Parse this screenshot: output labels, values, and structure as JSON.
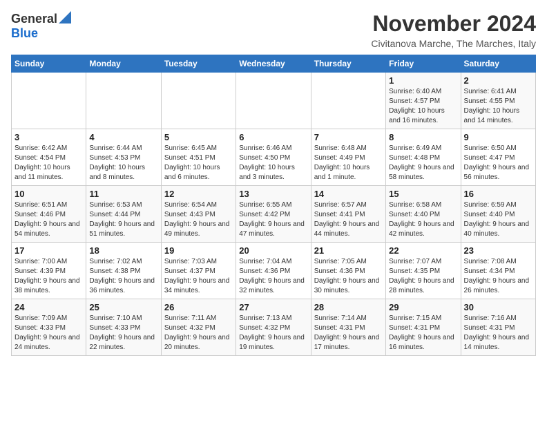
{
  "logo": {
    "general": "General",
    "blue": "Blue"
  },
  "title": "November 2024",
  "location": "Civitanova Marche, The Marches, Italy",
  "days_header": [
    "Sunday",
    "Monday",
    "Tuesday",
    "Wednesday",
    "Thursday",
    "Friday",
    "Saturday"
  ],
  "weeks": [
    [
      {
        "day": "",
        "info": ""
      },
      {
        "day": "",
        "info": ""
      },
      {
        "day": "",
        "info": ""
      },
      {
        "day": "",
        "info": ""
      },
      {
        "day": "",
        "info": ""
      },
      {
        "day": "1",
        "info": "Sunrise: 6:40 AM\nSunset: 4:57 PM\nDaylight: 10 hours and 16 minutes."
      },
      {
        "day": "2",
        "info": "Sunrise: 6:41 AM\nSunset: 4:55 PM\nDaylight: 10 hours and 14 minutes."
      }
    ],
    [
      {
        "day": "3",
        "info": "Sunrise: 6:42 AM\nSunset: 4:54 PM\nDaylight: 10 hours and 11 minutes."
      },
      {
        "day": "4",
        "info": "Sunrise: 6:44 AM\nSunset: 4:53 PM\nDaylight: 10 hours and 8 minutes."
      },
      {
        "day": "5",
        "info": "Sunrise: 6:45 AM\nSunset: 4:51 PM\nDaylight: 10 hours and 6 minutes."
      },
      {
        "day": "6",
        "info": "Sunrise: 6:46 AM\nSunset: 4:50 PM\nDaylight: 10 hours and 3 minutes."
      },
      {
        "day": "7",
        "info": "Sunrise: 6:48 AM\nSunset: 4:49 PM\nDaylight: 10 hours and 1 minute."
      },
      {
        "day": "8",
        "info": "Sunrise: 6:49 AM\nSunset: 4:48 PM\nDaylight: 9 hours and 58 minutes."
      },
      {
        "day": "9",
        "info": "Sunrise: 6:50 AM\nSunset: 4:47 PM\nDaylight: 9 hours and 56 minutes."
      }
    ],
    [
      {
        "day": "10",
        "info": "Sunrise: 6:51 AM\nSunset: 4:46 PM\nDaylight: 9 hours and 54 minutes."
      },
      {
        "day": "11",
        "info": "Sunrise: 6:53 AM\nSunset: 4:44 PM\nDaylight: 9 hours and 51 minutes."
      },
      {
        "day": "12",
        "info": "Sunrise: 6:54 AM\nSunset: 4:43 PM\nDaylight: 9 hours and 49 minutes."
      },
      {
        "day": "13",
        "info": "Sunrise: 6:55 AM\nSunset: 4:42 PM\nDaylight: 9 hours and 47 minutes."
      },
      {
        "day": "14",
        "info": "Sunrise: 6:57 AM\nSunset: 4:41 PM\nDaylight: 9 hours and 44 minutes."
      },
      {
        "day": "15",
        "info": "Sunrise: 6:58 AM\nSunset: 4:40 PM\nDaylight: 9 hours and 42 minutes."
      },
      {
        "day": "16",
        "info": "Sunrise: 6:59 AM\nSunset: 4:40 PM\nDaylight: 9 hours and 40 minutes."
      }
    ],
    [
      {
        "day": "17",
        "info": "Sunrise: 7:00 AM\nSunset: 4:39 PM\nDaylight: 9 hours and 38 minutes."
      },
      {
        "day": "18",
        "info": "Sunrise: 7:02 AM\nSunset: 4:38 PM\nDaylight: 9 hours and 36 minutes."
      },
      {
        "day": "19",
        "info": "Sunrise: 7:03 AM\nSunset: 4:37 PM\nDaylight: 9 hours and 34 minutes."
      },
      {
        "day": "20",
        "info": "Sunrise: 7:04 AM\nSunset: 4:36 PM\nDaylight: 9 hours and 32 minutes."
      },
      {
        "day": "21",
        "info": "Sunrise: 7:05 AM\nSunset: 4:36 PM\nDaylight: 9 hours and 30 minutes."
      },
      {
        "day": "22",
        "info": "Sunrise: 7:07 AM\nSunset: 4:35 PM\nDaylight: 9 hours and 28 minutes."
      },
      {
        "day": "23",
        "info": "Sunrise: 7:08 AM\nSunset: 4:34 PM\nDaylight: 9 hours and 26 minutes."
      }
    ],
    [
      {
        "day": "24",
        "info": "Sunrise: 7:09 AM\nSunset: 4:33 PM\nDaylight: 9 hours and 24 minutes."
      },
      {
        "day": "25",
        "info": "Sunrise: 7:10 AM\nSunset: 4:33 PM\nDaylight: 9 hours and 22 minutes."
      },
      {
        "day": "26",
        "info": "Sunrise: 7:11 AM\nSunset: 4:32 PM\nDaylight: 9 hours and 20 minutes."
      },
      {
        "day": "27",
        "info": "Sunrise: 7:13 AM\nSunset: 4:32 PM\nDaylight: 9 hours and 19 minutes."
      },
      {
        "day": "28",
        "info": "Sunrise: 7:14 AM\nSunset: 4:31 PM\nDaylight: 9 hours and 17 minutes."
      },
      {
        "day": "29",
        "info": "Sunrise: 7:15 AM\nSunset: 4:31 PM\nDaylight: 9 hours and 16 minutes."
      },
      {
        "day": "30",
        "info": "Sunrise: 7:16 AM\nSunset: 4:31 PM\nDaylight: 9 hours and 14 minutes."
      }
    ]
  ]
}
